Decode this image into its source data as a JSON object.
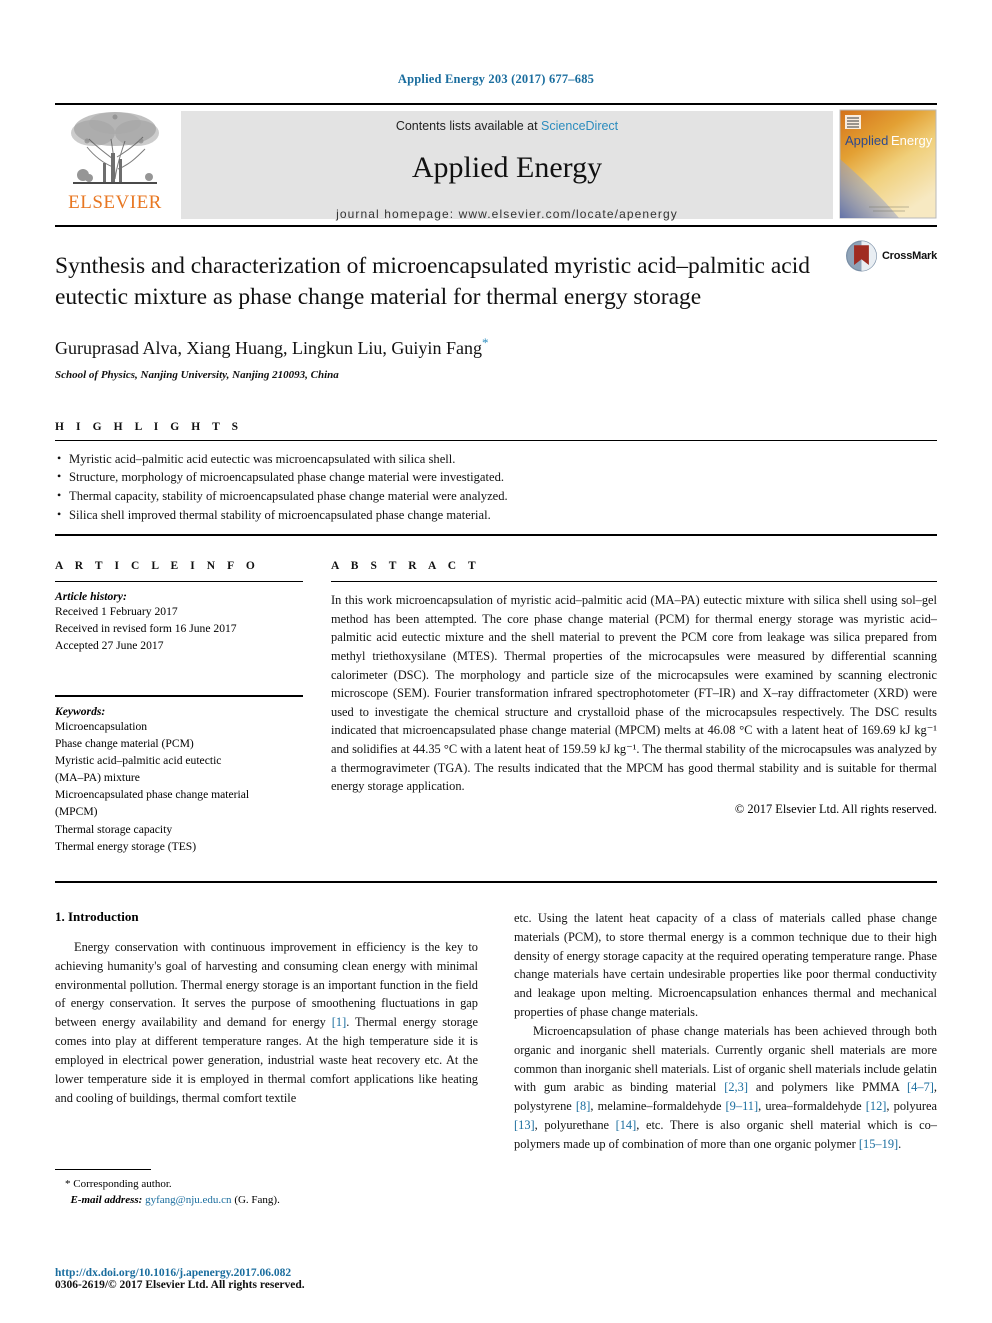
{
  "running_head": "Applied Energy 203 (2017) 677–685",
  "masthead": {
    "publisher_name": "ELSEVIER",
    "contents_prefix": "Contents lists available at ",
    "contents_link": "ScienceDirect",
    "journal_name": "Applied Energy",
    "homepage_line": "journal homepage: www.elsevier.com/locate/apenergy",
    "cover": {
      "title_part1": "Applied",
      "title_part2": "Energy"
    }
  },
  "article": {
    "title": "Synthesis and characterization of microencapsulated myristic acid–palmitic acid eutectic mixture as phase change material for thermal energy storage",
    "authors": "Guruprasad Alva, Xiang Huang, Lingkun Liu, Guiyin Fang",
    "corresponding_marker": "*",
    "affiliation": "School of Physics, Nanjing University, Nanjing 210093, China",
    "crossmark_label": "CrossMark"
  },
  "highlights": {
    "heading": "H I G H L I G H T S",
    "items": [
      "Myristic acid–palmitic acid eutectic was microencapsulated with silica shell.",
      "Structure, morphology of microencapsulated phase change material were investigated.",
      "Thermal capacity, stability of microencapsulated phase change material were analyzed.",
      "Silica shell improved thermal stability of microencapsulated phase change material."
    ]
  },
  "article_info": {
    "heading": "A R T I C L E  I N F O",
    "history_label": "Article history:",
    "history": [
      "Received 1 February 2017",
      "Received in revised form 16 June 2017",
      "Accepted 27 June 2017"
    ],
    "keywords_label": "Keywords:",
    "keywords": [
      "Microencapsulation",
      "Phase change material (PCM)",
      "Myristic acid–palmitic acid eutectic",
      "(MA–PA) mixture",
      "Microencapsulated phase change material",
      "(MPCM)",
      "Thermal storage capacity",
      "Thermal energy storage (TES)"
    ]
  },
  "abstract": {
    "heading": "A B S T R A C T",
    "text": "In this work microencapsulation of myristic acid–palmitic acid (MA–PA) eutectic mixture with silica shell using sol–gel method has been attempted. The core phase change material (PCM) for thermal energy storage was myristic acid–palmitic acid eutectic mixture and the shell material to prevent the PCM core from leakage was silica prepared from methyl triethoxysilane (MTES). Thermal properties of the microcapsules were measured by differential scanning calorimeter (DSC). The morphology and particle size of the microcapsules were examined by scanning electronic microscope (SEM). Fourier transformation infrared spectrophotometer (FT–IR) and X–ray diffractometer (XRD) were used to investigate the chemical structure and crystalloid phase of the microcapsules respectively. The DSC results indicated that microencapsulated phase change material (MPCM) melts at 46.08 °C with a latent heat of 169.69 kJ kg⁻¹ and solidifies at 44.35 °C with a latent heat of 159.59 kJ kg⁻¹. The thermal stability of the microcapsules was analyzed by a thermogravimeter (TGA). The results indicated that the MPCM has good thermal stability and is suitable for thermal energy storage application.",
    "copyright": "© 2017 Elsevier Ltd. All rights reserved."
  },
  "body": {
    "section_number_title": "1. Introduction",
    "left_paragraph_1": "Energy conservation with continuous improvement in efficiency is the key to achieving humanity's goal of harvesting and consuming clean energy with minimal environmental pollution. Thermal energy storage is an important function in the field of energy conservation. It serves the purpose of smoothening fluctuations in gap between energy availability and demand for energy ",
    "left_ref_1": "[1]",
    "left_paragraph_1b": ". Thermal energy storage comes into play at different temperature ranges. At the high temperature side it is employed in electrical power generation, industrial waste heat recovery etc. At the lower temperature side it is employed in thermal comfort applications like heating and cooling of buildings, thermal comfort textile",
    "right_paragraph_1": "etc. Using the latent heat capacity of a class of materials called phase change materials (PCM), to store thermal energy is a common technique due to their high density of energy storage capacity at the required operating temperature range. Phase change materials have certain undesirable properties like poor thermal conductivity and leakage upon melting. Microencapsulation enhances thermal and mechanical properties of phase change materials.",
    "right_paragraph_2a": "Microencapsulation of phase change materials has been achieved through both organic and inorganic shell materials. Currently organic shell materials are more common than inorganic shell materials. List of organic shell materials include gelatin with gum arabic as binding material ",
    "right_ref_23": "[2,3]",
    "right_paragraph_2b": " and polymers like PMMA ",
    "right_ref_47": "[4–7]",
    "right_paragraph_2c": ", polystyrene ",
    "right_ref_8": "[8]",
    "right_paragraph_2d": ", melamine–formaldehyde ",
    "right_ref_911": "[9–11]",
    "right_paragraph_2e": ", urea–formaldehyde ",
    "right_ref_12": "[12]",
    "right_paragraph_2f": ", polyurea ",
    "right_ref_13": "[13]",
    "right_paragraph_2g": ", polyurethane ",
    "right_ref_14": "[14]",
    "right_paragraph_2h": ", etc. There is also organic shell material which is co–polymers made up of combination of more than one organic polymer ",
    "right_ref_1519": "[15–19]",
    "right_paragraph_2i": "."
  },
  "footnote": {
    "marker": "*",
    "corresponding": "Corresponding author.",
    "email_label": "E-mail address:",
    "email": "gyfang@nju.edu.cn",
    "email_suffix": "(G. Fang)."
  },
  "page_footer": {
    "doi": "http://dx.doi.org/10.1016/j.apenergy.2017.06.082",
    "issn": "0306-2619/© 2017 Elsevier Ltd. All rights reserved."
  },
  "colors": {
    "link_blue": "#1a6d9e",
    "sciencedirect_blue": "#2b8cbe",
    "elsevier_orange": "#e87722",
    "band_gray": "#e3e3e3",
    "crossmark_red": "#a02c22"
  }
}
